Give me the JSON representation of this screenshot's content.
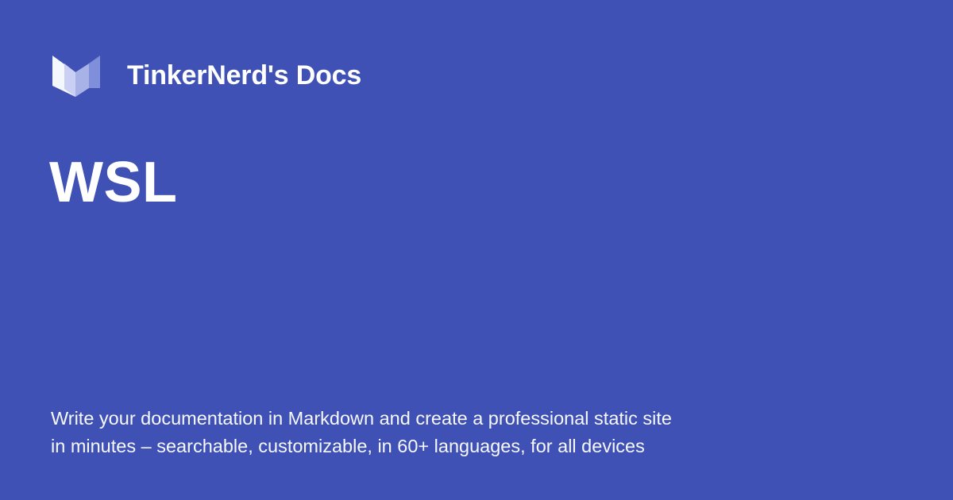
{
  "brand": {
    "logo_icon": "material-logo-icon",
    "site_name": "TinkerNerd's Docs"
  },
  "page": {
    "title": "WSL"
  },
  "description": {
    "line1": "Write your documentation in Markdown and create a professional static site",
    "line2": "in minutes – searchable, customizable, in 60+ languages, for all devices"
  },
  "colors": {
    "background": "#3f51b5",
    "text": "#ffffff",
    "logo_light": "#f5f7ff",
    "logo_mid": "#a9b2e6",
    "logo_dark": "#7f8fd9"
  }
}
